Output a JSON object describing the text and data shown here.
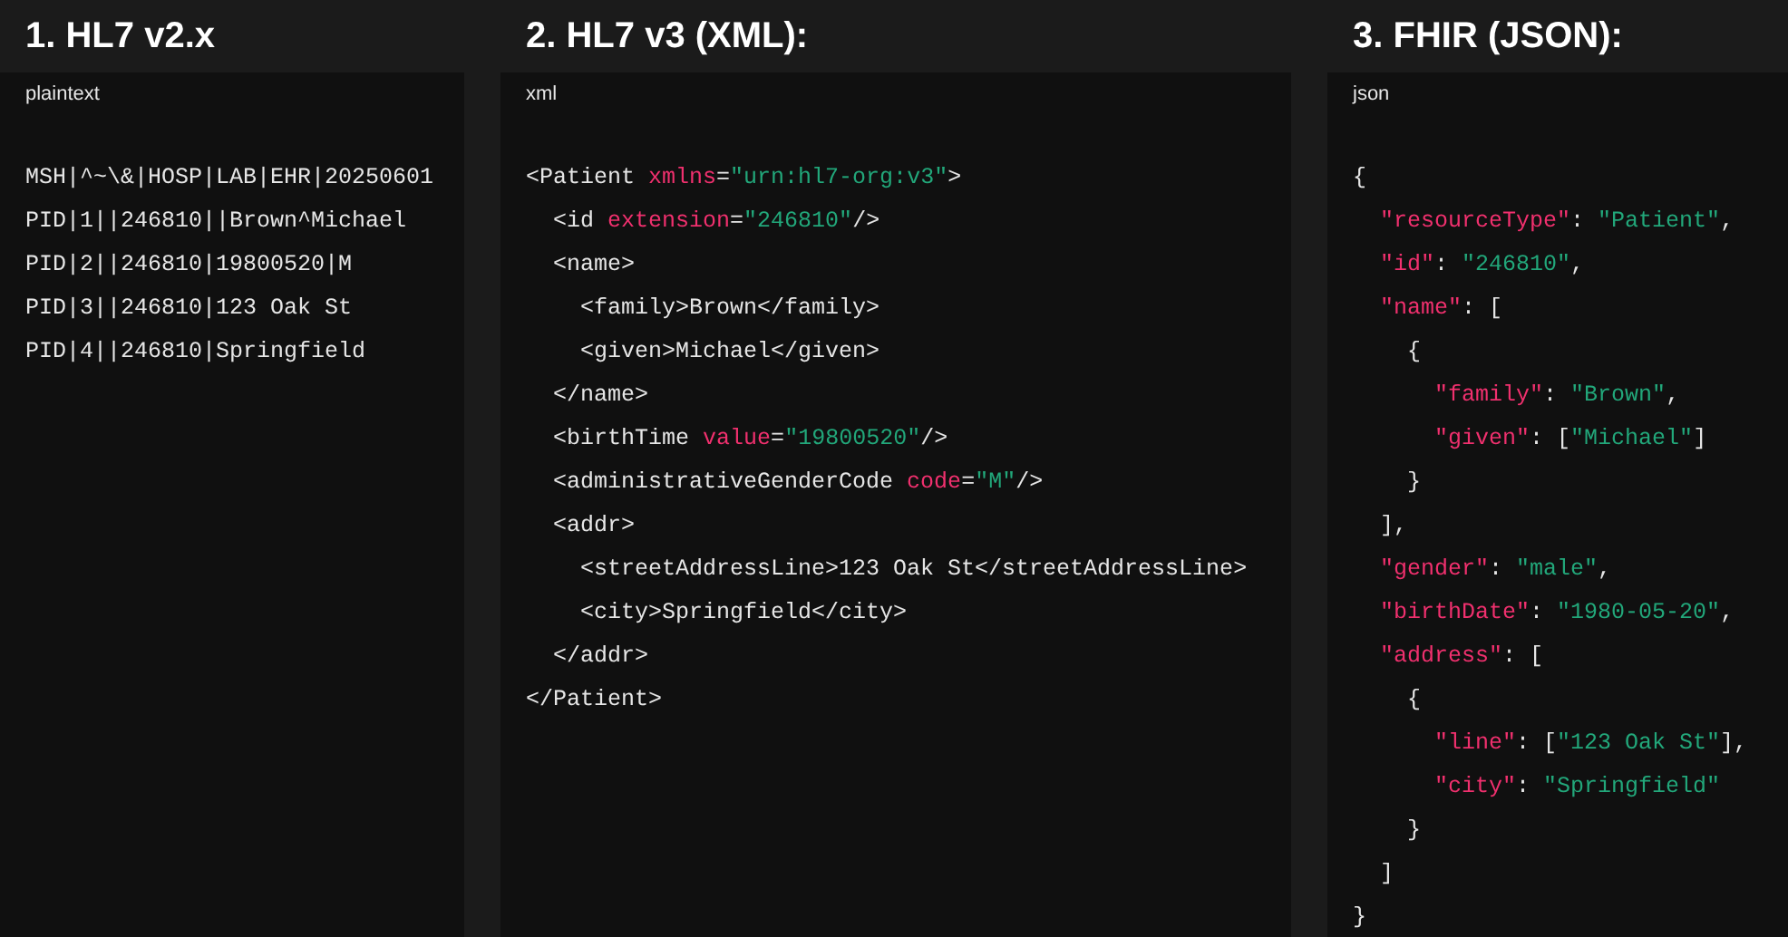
{
  "panels": [
    {
      "heading": "1. HL7 v2.x",
      "language": "plaintext",
      "lines": [
        [
          {
            "kind": "text",
            "text": "MSH|^~\\&|HOSP|LAB|EHR|20250601"
          }
        ],
        [
          {
            "kind": "text",
            "text": "PID|1||246810||Brown^Michael"
          }
        ],
        [
          {
            "kind": "text",
            "text": "PID|2||246810|19800520|M"
          }
        ],
        [
          {
            "kind": "text",
            "text": "PID|3||246810|123 Oak St"
          }
        ],
        [
          {
            "kind": "text",
            "text": "PID|4||246810|Springfield"
          }
        ]
      ]
    },
    {
      "heading": "2. HL7 v3 (XML):",
      "language": "xml",
      "lines": [
        [
          {
            "kind": "text",
            "text": "<Patient "
          },
          {
            "kind": "attr",
            "text": "xmlns"
          },
          {
            "kind": "text",
            "text": "="
          },
          {
            "kind": "string",
            "text": "\"urn:hl7-org:v3\""
          },
          {
            "kind": "text",
            "text": ">"
          }
        ],
        [
          {
            "kind": "text",
            "text": "  <id "
          },
          {
            "kind": "attr",
            "text": "extension"
          },
          {
            "kind": "text",
            "text": "="
          },
          {
            "kind": "string",
            "text": "\"246810\""
          },
          {
            "kind": "text",
            "text": "/>"
          }
        ],
        [
          {
            "kind": "text",
            "text": "  <name>"
          }
        ],
        [
          {
            "kind": "text",
            "text": "    <family>Brown</family>"
          }
        ],
        [
          {
            "kind": "text",
            "text": "    <given>Michael</given>"
          }
        ],
        [
          {
            "kind": "text",
            "text": "  </name>"
          }
        ],
        [
          {
            "kind": "text",
            "text": "  <birthTime "
          },
          {
            "kind": "attr",
            "text": "value"
          },
          {
            "kind": "text",
            "text": "="
          },
          {
            "kind": "string",
            "text": "\"19800520\""
          },
          {
            "kind": "text",
            "text": "/>"
          }
        ],
        [
          {
            "kind": "text",
            "text": "  <administrativeGenderCode "
          },
          {
            "kind": "attr",
            "text": "code"
          },
          {
            "kind": "text",
            "text": "="
          },
          {
            "kind": "string",
            "text": "\"M\""
          },
          {
            "kind": "text",
            "text": "/>"
          }
        ],
        [
          {
            "kind": "text",
            "text": "  <addr>"
          }
        ],
        [
          {
            "kind": "text",
            "text": "    <streetAddressLine>123 Oak St</streetAddressLine>"
          }
        ],
        [
          {
            "kind": "text",
            "text": "    <city>Springfield</city>"
          }
        ],
        [
          {
            "kind": "text",
            "text": "  </addr>"
          }
        ],
        [
          {
            "kind": "text",
            "text": "</Patient>"
          }
        ]
      ]
    },
    {
      "heading": "3. FHIR (JSON):",
      "language": "json",
      "lines": [
        [
          {
            "kind": "text",
            "text": "{"
          }
        ],
        [
          {
            "kind": "attr",
            "text": "  \"resourceType\""
          },
          {
            "kind": "text",
            "text": ": "
          },
          {
            "kind": "string",
            "text": "\"Patient\""
          },
          {
            "kind": "text",
            "text": ","
          }
        ],
        [
          {
            "kind": "attr",
            "text": "  \"id\""
          },
          {
            "kind": "text",
            "text": ": "
          },
          {
            "kind": "string",
            "text": "\"246810\""
          },
          {
            "kind": "text",
            "text": ","
          }
        ],
        [
          {
            "kind": "attr",
            "text": "  \"name\""
          },
          {
            "kind": "text",
            "text": ": ["
          }
        ],
        [
          {
            "kind": "text",
            "text": "    {"
          }
        ],
        [
          {
            "kind": "attr",
            "text": "      \"family\""
          },
          {
            "kind": "text",
            "text": ": "
          },
          {
            "kind": "string",
            "text": "\"Brown\""
          },
          {
            "kind": "text",
            "text": ","
          }
        ],
        [
          {
            "kind": "attr",
            "text": "      \"given\""
          },
          {
            "kind": "text",
            "text": ": ["
          },
          {
            "kind": "string",
            "text": "\"Michael\""
          },
          {
            "kind": "text",
            "text": "]"
          }
        ],
        [
          {
            "kind": "text",
            "text": "    }"
          }
        ],
        [
          {
            "kind": "text",
            "text": "  ],"
          }
        ],
        [
          {
            "kind": "attr",
            "text": "  \"gender\""
          },
          {
            "kind": "text",
            "text": ": "
          },
          {
            "kind": "string",
            "text": "\"male\""
          },
          {
            "kind": "text",
            "text": ","
          }
        ],
        [
          {
            "kind": "attr",
            "text": "  \"birthDate\""
          },
          {
            "kind": "text",
            "text": ": "
          },
          {
            "kind": "string",
            "text": "\"1980-05-20\""
          },
          {
            "kind": "text",
            "text": ","
          }
        ],
        [
          {
            "kind": "attr",
            "text": "  \"address\""
          },
          {
            "kind": "text",
            "text": ": ["
          }
        ],
        [
          {
            "kind": "text",
            "text": "    {"
          }
        ],
        [
          {
            "kind": "attr",
            "text": "      \"line\""
          },
          {
            "kind": "text",
            "text": ": ["
          },
          {
            "kind": "string",
            "text": "\"123 Oak St\""
          },
          {
            "kind": "text",
            "text": "],"
          }
        ],
        [
          {
            "kind": "attr",
            "text": "      \"city\""
          },
          {
            "kind": "text",
            "text": ": "
          },
          {
            "kind": "string",
            "text": "\"Springfield\""
          }
        ],
        [
          {
            "kind": "text",
            "text": "    }"
          }
        ],
        [
          {
            "kind": "text",
            "text": "  ]"
          }
        ],
        [
          {
            "kind": "text",
            "text": "}"
          }
        ]
      ]
    }
  ]
}
